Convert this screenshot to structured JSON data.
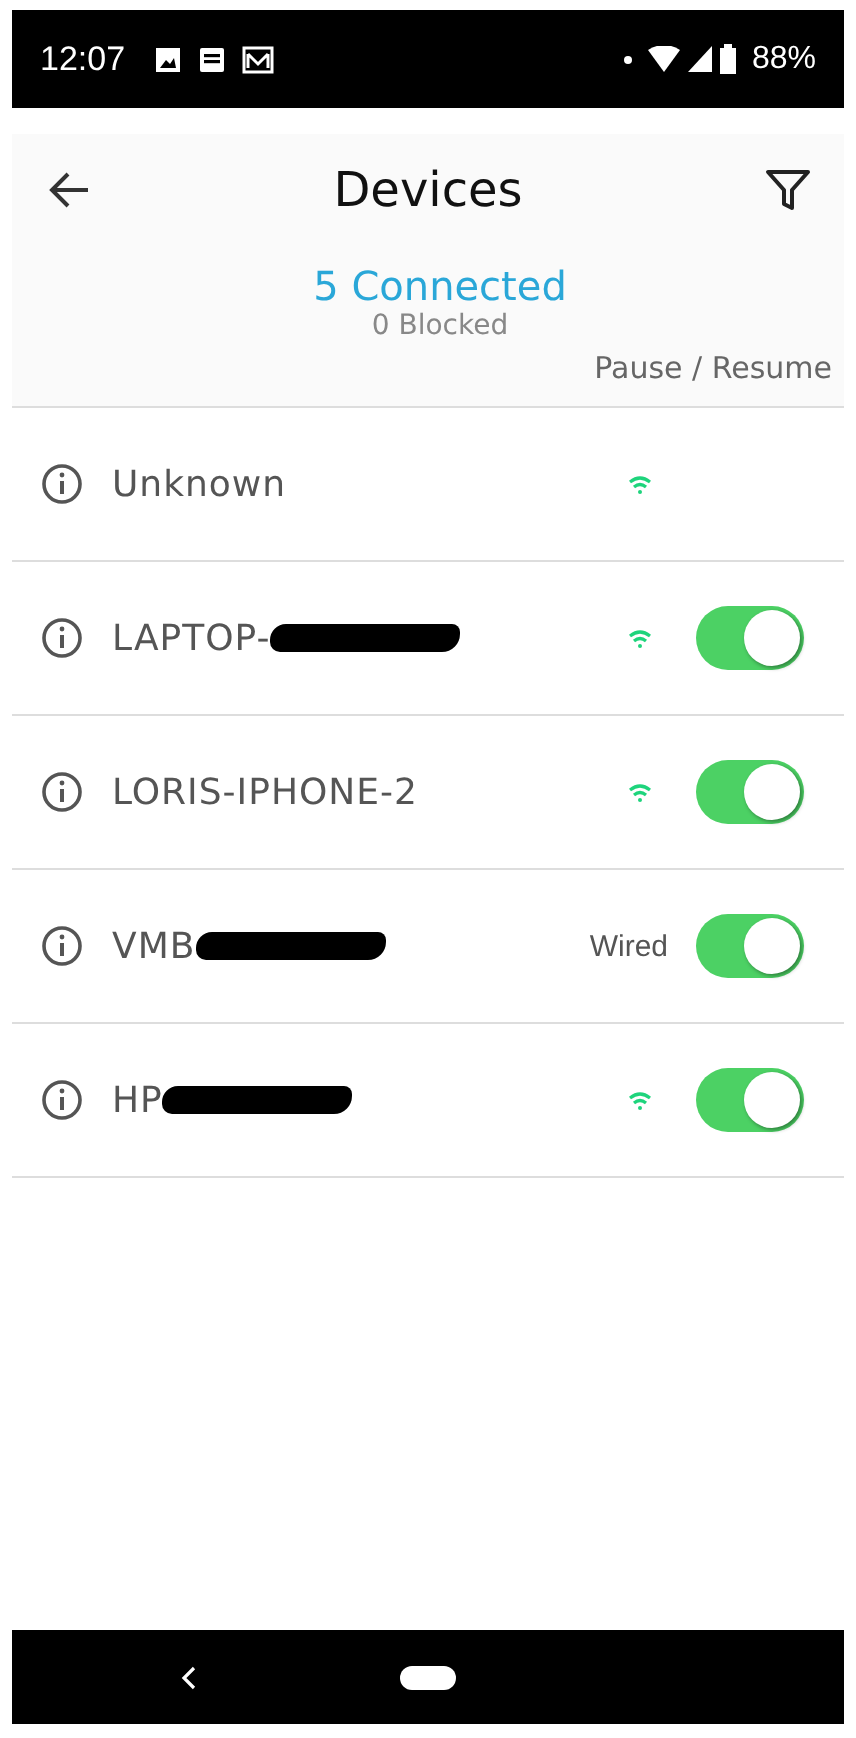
{
  "status_bar": {
    "time": "12:07",
    "battery": "88%"
  },
  "header": {
    "title": "Devices"
  },
  "summary": {
    "connected": "5 Connected",
    "blocked": "0 Blocked",
    "column_label": "Pause / Resume"
  },
  "devices": [
    {
      "name": "Unknown",
      "kind": "wifi"
    },
    {
      "name": "LAPTOP-",
      "redacted": true,
      "kind": "wifi",
      "on": true
    },
    {
      "name": "LORIS-IPHONE-2",
      "kind": "wifi",
      "on": true
    },
    {
      "name": "VMB",
      "redacted": true,
      "kind": "wired",
      "connection_label": "Wired",
      "on": true
    },
    {
      "name": "HP",
      "redacted": true,
      "kind": "wifi",
      "on": true
    }
  ]
}
